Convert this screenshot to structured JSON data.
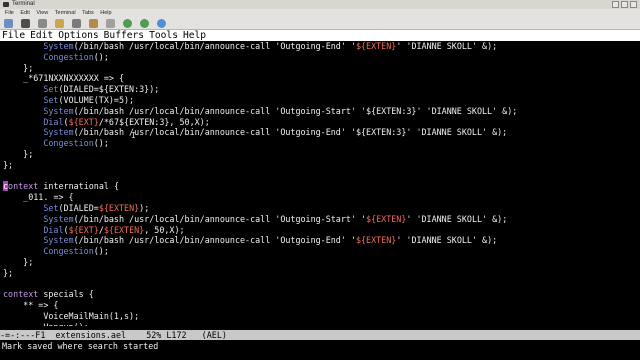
{
  "window": {
    "title": "Terminal"
  },
  "terminal_menu": [
    "File",
    "Edit",
    "View",
    "Terminal",
    "Tabs",
    "Help"
  ],
  "toolbar_icons": [
    "new-tab-icon",
    "new-window-icon",
    "copy-icon",
    "paste-icon",
    "find-icon",
    "preferences-icon",
    "zoom-icon",
    "bookmark-icon",
    "settings-icon",
    "help-icon"
  ],
  "emacs_menu": [
    "File",
    "Edit",
    "Options",
    "Buffers",
    "Tools",
    "Help"
  ],
  "code_lines": [
    [
      [
        "fn",
        "        System"
      ],
      [
        "",
        "(/bin/bash /usr/local/bin/announce-call 'Outgoing-End' '"
      ],
      [
        "var",
        "${EXTEN}"
      ],
      [
        "",
        "' 'DIANNE SKOLL' &);"
      ]
    ],
    [
      [
        "fn",
        "        Congestion"
      ],
      [
        "",
        "();"
      ]
    ],
    [
      [
        "",
        "    };"
      ]
    ],
    [
      [
        "",
        "    _*671NXXNXXXXXX => {"
      ]
    ],
    [
      [
        "fn",
        "        Set"
      ],
      [
        "",
        "(DIALED=${EXTEN:3});"
      ]
    ],
    [
      [
        "fn",
        "        Set"
      ],
      [
        "",
        "(VOLUME(TX)=5);"
      ]
    ],
    [
      [
        "fn",
        "        System"
      ],
      [
        "",
        "(/bin/bash /usr/local/bin/announce-call 'Outgoing-Start' '${EXTEN:3}' 'DIANNE SKOLL' &);"
      ]
    ],
    [
      [
        "fn",
        "        Dial"
      ],
      [
        "",
        "("
      ],
      [
        "var",
        "${EXT}"
      ],
      [
        "",
        "/*67${EXTEN:3}, 50,X);"
      ]
    ],
    [
      [
        "fn",
        "        System"
      ],
      [
        "",
        "(/bin/bash /usr/local/bin/announce-call 'Outgoing-End' '${EXTEN:3}' 'DIANNE SKOLL' &);"
      ]
    ],
    [
      [
        "fn",
        "        Congestion"
      ],
      [
        "",
        "();"
      ]
    ],
    [
      [
        "",
        "    };"
      ]
    ],
    [
      [
        "",
        "};"
      ]
    ],
    [
      [
        "",
        ""
      ]
    ],
    [
      [
        "cursor",
        "c"
      ],
      [
        "kw",
        "ontext"
      ],
      [
        "",
        " international {"
      ]
    ],
    [
      [
        "",
        "    _011. => {"
      ]
    ],
    [
      [
        "fn",
        "        Set"
      ],
      [
        "",
        "(DIALED="
      ],
      [
        "var",
        "${EXTEN}"
      ],
      [
        "",
        ");"
      ]
    ],
    [
      [
        "fn",
        "        System"
      ],
      [
        "",
        "(/bin/bash /usr/local/bin/announce-call 'Outgoing-Start' '"
      ],
      [
        "var",
        "${EXTEN}"
      ],
      [
        "",
        "' 'DIANNE SKOLL' &);"
      ]
    ],
    [
      [
        "fn",
        "        Dial"
      ],
      [
        "",
        "("
      ],
      [
        "var",
        "${EXT}"
      ],
      [
        "",
        "/"
      ],
      [
        "var",
        "${EXTEN}"
      ],
      [
        "",
        ", 50,X);"
      ]
    ],
    [
      [
        "fn",
        "        System"
      ],
      [
        "",
        "(/bin/bash /usr/local/bin/announce-call 'Outgoing-End' '"
      ],
      [
        "var",
        "${EXTEN}"
      ],
      [
        "",
        "' 'DIANNE SKOLL' &);"
      ]
    ],
    [
      [
        "fn",
        "        Congestion"
      ],
      [
        "",
        "();"
      ]
    ],
    [
      [
        "",
        "    };"
      ]
    ],
    [
      [
        "",
        "};"
      ]
    ],
    [
      [
        "",
        ""
      ]
    ],
    [
      [
        "kw",
        "context"
      ],
      [
        "",
        " specials {"
      ]
    ],
    [
      [
        "",
        "    ** => {"
      ]
    ],
    [
      [
        "",
        "        VoiceMailMain(1,s);"
      ]
    ],
    [
      [
        "",
        "        Hangup();"
      ]
    ]
  ],
  "mode_line": "-=-:---F1  extensions.ael    52% L172   (AEL) ",
  "echo_area": "Mark saved where search started"
}
